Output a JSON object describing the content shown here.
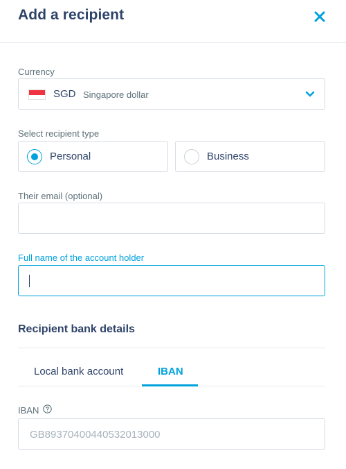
{
  "header": {
    "title": "Add a recipient"
  },
  "currency": {
    "label": "Currency",
    "code": "SGD",
    "name": "Singapore dollar"
  },
  "recipient_type": {
    "label": "Select recipient type",
    "options": [
      {
        "label": "Personal",
        "selected": true
      },
      {
        "label": "Business",
        "selected": false
      }
    ]
  },
  "email": {
    "label": "Their email (optional)",
    "value": ""
  },
  "full_name": {
    "label": "Full name of the account holder",
    "value": ""
  },
  "bank_details": {
    "title": "Recipient bank details",
    "tabs": [
      {
        "label": "Local bank account",
        "active": false
      },
      {
        "label": "IBAN",
        "active": true
      }
    ]
  },
  "iban": {
    "label": "IBAN",
    "placeholder": "GB89370400440532013000"
  },
  "colors": {
    "accent": "#00a2dd",
    "text": "#2e4369",
    "border": "#d6dde4"
  },
  "icons": {
    "close": "close-icon",
    "chevron": "chevron-down-icon",
    "help": "help-circle-icon",
    "flag": "singapore-flag-icon"
  }
}
